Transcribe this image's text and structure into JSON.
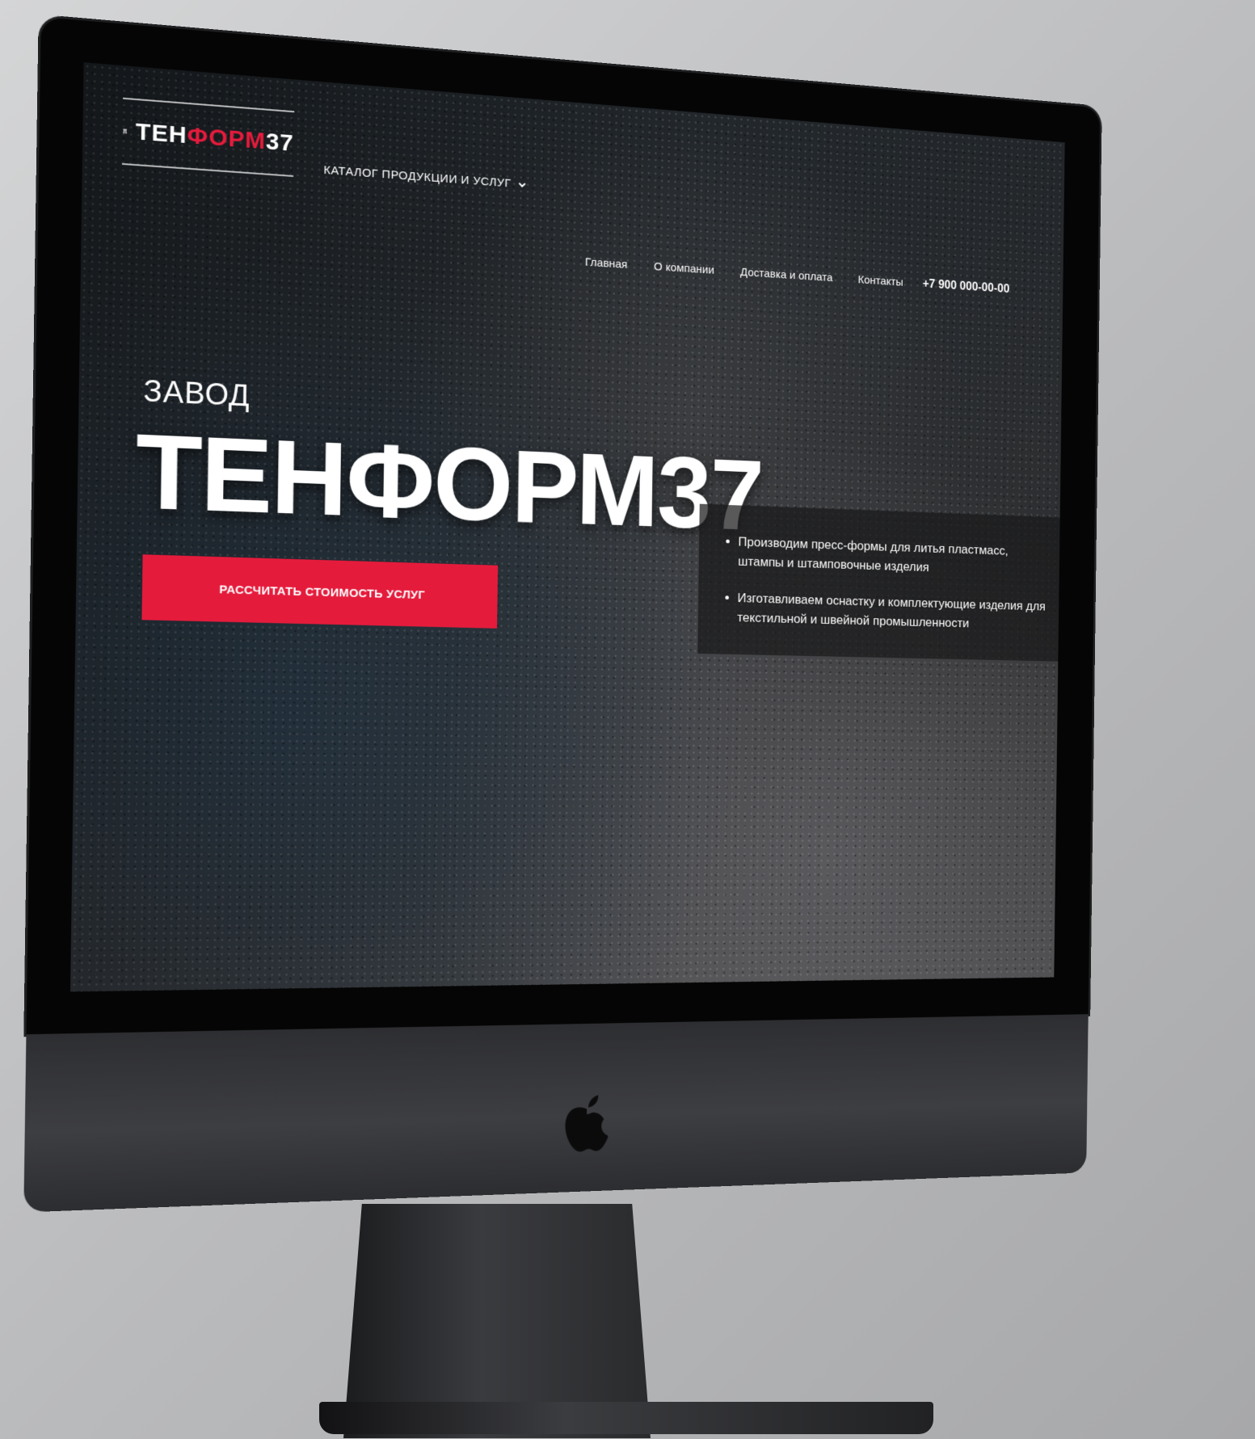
{
  "site": {
    "logo": {
      "text_white": "ТЕН",
      "text_red": "ФОРМ",
      "text_suffix": "37"
    },
    "catalog_menu": {
      "label": "КАТАЛОГ ПРОДУКЦИИ И УСЛУГ",
      "icon": "chevron-down-icon"
    },
    "nav": [
      "Главная",
      "О компании",
      "Доставка и оплата",
      "Контакты"
    ],
    "phone": "+7 900 000-00-00",
    "hero": {
      "subtitle": "ЗАВОД",
      "title": "ТЕНФОРМ37",
      "cta_label": "РАССЧИТАТЬ СТОИМОСТЬ УСЛУГ",
      "features": [
        "Производим пресс-формы для литья пластмасс, штампы и штамповочные изделия",
        "Изготавливаем оснастку и комплектующие изделия для текстильной и швейной промышленности"
      ]
    }
  },
  "colors": {
    "accent": "#e51b3c",
    "bezel": "#050505",
    "chin": "#3a3b3f"
  },
  "device": {
    "logo_icon": "apple-logo-icon"
  }
}
